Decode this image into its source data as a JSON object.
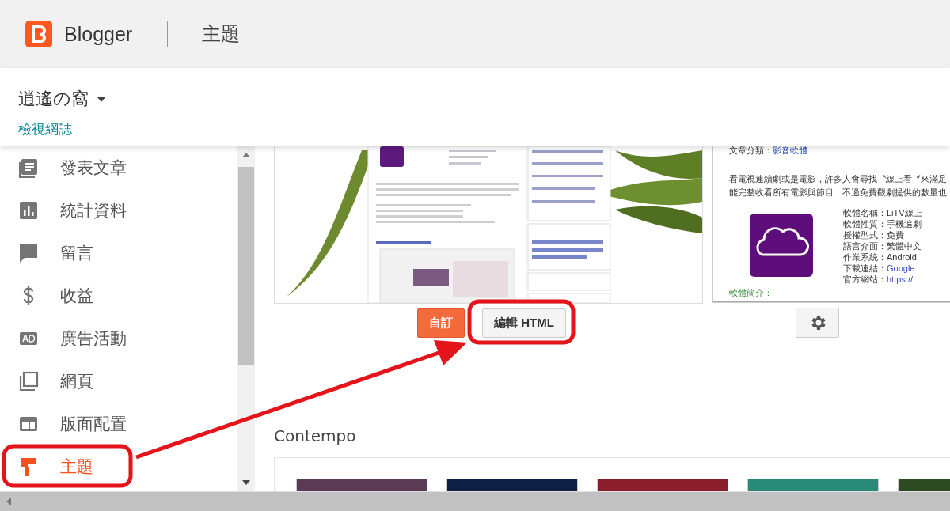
{
  "header": {
    "brand": "Blogger",
    "page_title": "主題"
  },
  "blog": {
    "name": "逍遙の窩",
    "view_link": "檢視網誌"
  },
  "sidebar": {
    "items": [
      {
        "label": "發表文章",
        "kind": "posts",
        "selected": false
      },
      {
        "label": "統計資料",
        "kind": "stats",
        "selected": false
      },
      {
        "label": "留言",
        "kind": "comments",
        "selected": false
      },
      {
        "label": "收益",
        "kind": "earnings",
        "selected": false
      },
      {
        "label": "廣告活動",
        "kind": "ads",
        "selected": false
      },
      {
        "label": "網頁",
        "kind": "pages",
        "selected": false
      },
      {
        "label": "版面配置",
        "kind": "layout",
        "selected": false
      },
      {
        "label": "主題",
        "kind": "theme",
        "selected": true
      }
    ]
  },
  "current_theme": {
    "mobile_preview": {
      "category_label": "文章分類：",
      "category": "影音軟體",
      "intro_lines": [
        "看電視連續劇或是電影，許多人會尋找〝線上看〞來滿足",
        "能完整收看所有電影與節目，不過免費觀劇提供的數量也"
      ],
      "details": [
        {
          "label": "軟體名稱：",
          "value": "LiTV線上",
          "link": false
        },
        {
          "label": "軟體性質：",
          "value": "手機追劇",
          "link": false
        },
        {
          "label": "授權型式：",
          "value": "免費",
          "link": false
        },
        {
          "label": "語言介面：",
          "value": "繁體中文",
          "link": false
        },
        {
          "label": "作業系統：",
          "value": "Android",
          "link": false
        },
        {
          "label": "下載連結：",
          "value": "Google",
          "link": true
        },
        {
          "label": "官方網站：",
          "value": "https://",
          "link": true
        }
      ],
      "section_title": "軟體簡介："
    },
    "buttons": {
      "customize": "自訂",
      "edit_html": "編輯 HTML"
    }
  },
  "gallery": {
    "title": "Contempo",
    "thumbnails": [
      {
        "color": "#5a3a55"
      },
      {
        "color": "#0d1f45"
      },
      {
        "color": "#8a1e2a"
      },
      {
        "color": "#2a8a7a"
      },
      {
        "color": "#2e4a22"
      }
    ]
  }
}
